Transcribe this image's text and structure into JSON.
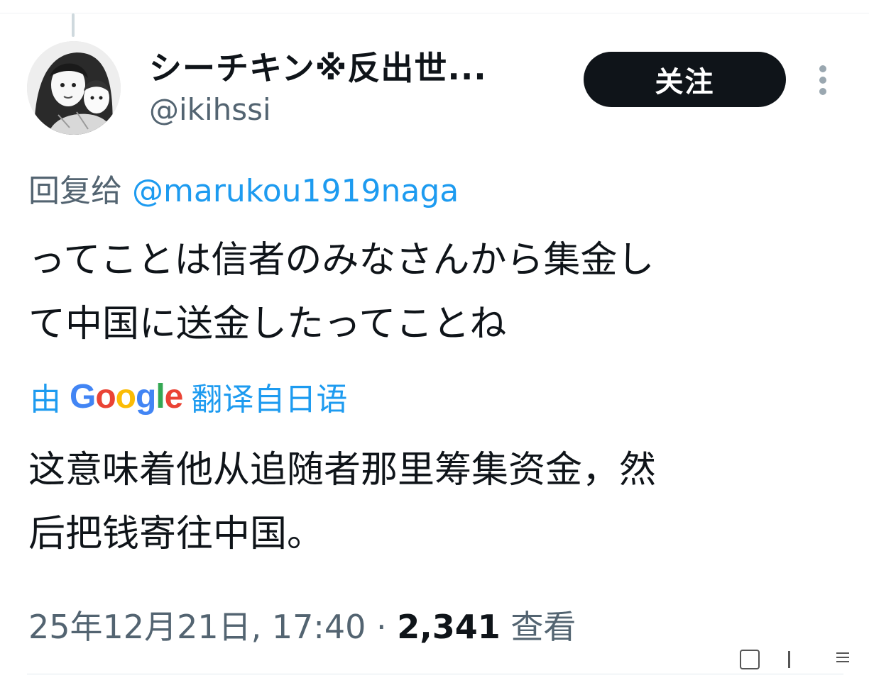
{
  "tweet": {
    "display_name": "シーチキン※反出世...",
    "handle": "@ikihssi",
    "follow_label": "关注",
    "reply_prefix": "回复给",
    "reply_to": "@marukou1919naga",
    "body_lines": [
      "ってことは信者のみなさんから集金し",
      "て中国に送金したってことね"
    ],
    "translation": {
      "prefix": "由",
      "provider": "Google",
      "suffix": "翻译自日语",
      "lines": [
        "这意味着他从追随者那里筹集资金，然",
        "后把钱寄往中国。"
      ]
    },
    "timestamp": "25年12月21日, 17:40 · ",
    "view_count": "2,341",
    "views_label": "查看"
  },
  "icons": {
    "avatar": "avatar-image",
    "more": "more-options-icon"
  },
  "colors": {
    "text": "#0f1419",
    "secondary": "#536471",
    "link": "#1d9bf0",
    "button_bg": "#0f1419"
  }
}
